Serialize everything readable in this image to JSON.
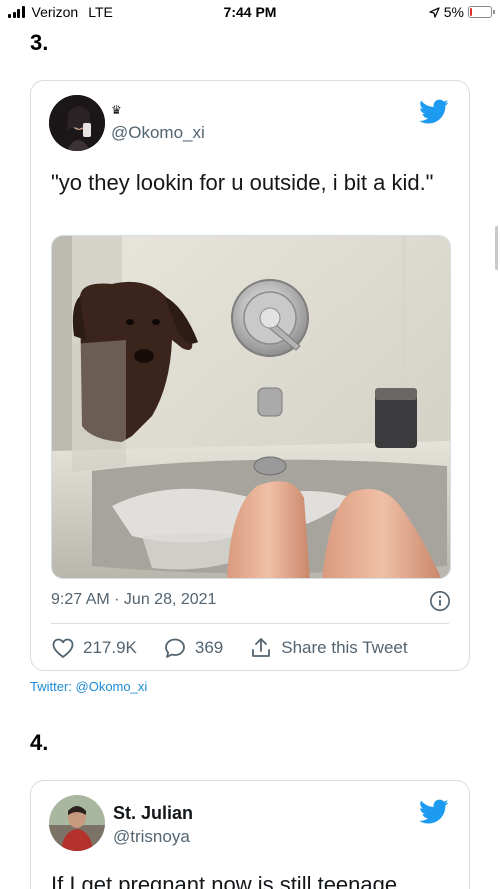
{
  "status_bar": {
    "carrier": "Verizon",
    "network": "LTE",
    "time": "7:44 PM",
    "battery": "5%",
    "battery_level": 0.05,
    "battery_color": "#e0302a"
  },
  "sections": [
    {
      "number": "3.",
      "tweet": {
        "display_name_icon": "crown-icon",
        "handle": "@Okomo_xi",
        "text": "\"yo they lookin for u outside, i bit a kid.\"",
        "image": "dog-peeking-into-bathtub-photo",
        "timestamp": "9:27 AM · Jun 28, 2021",
        "likes": "217.9K",
        "replies": "369",
        "share_label": "Share this Tweet"
      },
      "source": "Twitter: @Okomo_xi"
    },
    {
      "number": "4.",
      "tweet": {
        "display_name": "St. Julian",
        "handle": "@trisnoya",
        "text": "If I get pregnant now is still teenage"
      }
    }
  ],
  "colors": {
    "twitter_blue": "#1d9bf0",
    "link_blue": "#1d8ad6",
    "secondary_text": "#536471",
    "border": "#d8dde2"
  }
}
